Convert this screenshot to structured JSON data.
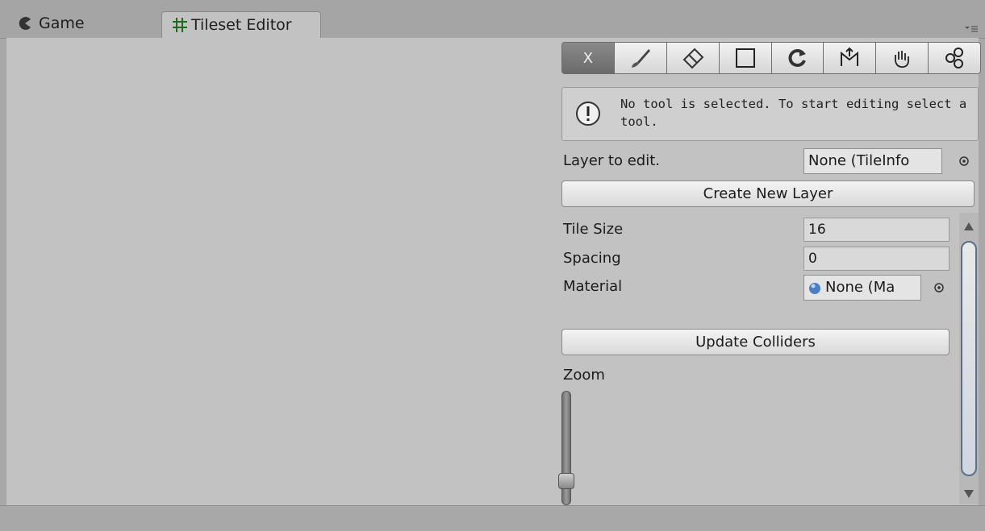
{
  "tabs": {
    "game": {
      "label": "Game",
      "icon": "pacman-icon"
    },
    "tileset": {
      "label": "Tileset Editor",
      "icon": "grid-icon"
    }
  },
  "toolbar": {
    "tools": [
      {
        "name": "none",
        "label": "X"
      },
      {
        "name": "paint",
        "icon": "brush-icon"
      },
      {
        "name": "erase",
        "icon": "eraser-icon"
      },
      {
        "name": "rectangle",
        "icon": "rectangle-icon"
      },
      {
        "name": "refresh",
        "icon": "refresh-icon"
      },
      {
        "name": "move",
        "icon": "move-icon"
      },
      {
        "name": "pick",
        "icon": "hand-pick-icon"
      },
      {
        "name": "flood",
        "icon": "flood-icon"
      }
    ]
  },
  "help": {
    "message": "No tool is selected. To start editing select a tool."
  },
  "layer": {
    "label": "Layer to edit.",
    "value": "None (TileInfo"
  },
  "buttons": {
    "create_layer": "Create New Layer",
    "update_colliders": "Update Colliders"
  },
  "fields": {
    "tile_size": {
      "label": "Tile Size",
      "value": "16"
    },
    "spacing": {
      "label": "Spacing",
      "value": "0"
    },
    "material": {
      "label": "Material",
      "value": "None (Ma"
    }
  },
  "zoom": {
    "label": "Zoom",
    "value_fraction": 0.1
  },
  "colors": {
    "panel": "#c2c2c2",
    "tabbar": "#a5a5a5",
    "selected_tool": "#7a7a7a",
    "scroll_accent": "#5a6f8a"
  }
}
